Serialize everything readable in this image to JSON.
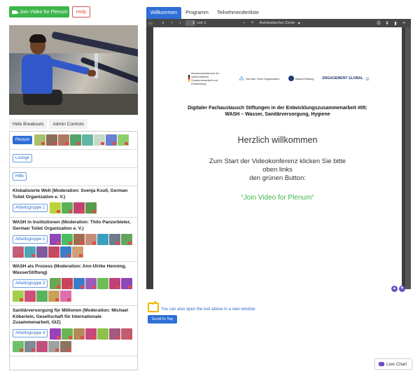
{
  "top_buttons": {
    "join": "Join Video for Plenum",
    "help": "Help"
  },
  "left_tabs": [
    "Hide Breakouts",
    "Admin Controls"
  ],
  "rooms": [
    {
      "title": "",
      "button": "Plenum",
      "primary": true,
      "avatars": [
        "#a8c16a",
        "#8a6d5a",
        "#b07a62",
        "#51a467",
        "#60b5a6",
        "#c5d9c5",
        "#6b7ecf",
        "#8fcf6b"
      ]
    },
    {
      "title": "",
      "button": "Lounge",
      "primary": false,
      "avatars": []
    },
    {
      "title": "",
      "button": "Hilfe",
      "primary": false,
      "avatars": []
    },
    {
      "title": "Klobalisierte Welt (Moderation: Svenja Ksoll, German Toilet Organization e. V.)",
      "button": "Arbeitsgruppe 1",
      "primary": false,
      "avatars": [
        "#b9d33b",
        "#5bb05a",
        "#c0426e",
        "#5c9a4d"
      ]
    },
    {
      "title": "WASH in Institutionen (Moderation: Thilo Panzerbieter, German Toilet Organization e. V.)",
      "button": "Arbeitsgruppe 2",
      "primary": false,
      "avatars": [
        "#8e48b8",
        "#4bbe5f",
        "#a06c50",
        "#c68d7a",
        "#3a9ec0",
        "#6f7a8a",
        "#63a55d",
        "#c0607b",
        "#4da6b8",
        "#7d5a9e",
        "#c14b62",
        "#3b7ec7",
        "#d0a070"
      ]
    },
    {
      "title": "WASH als Prozess (Moderation: Ann-Ulrike Henning, WasserStiftung)",
      "button": "Arbeitsgruppe 3",
      "primary": false,
      "avatars": [
        "#6aa84f",
        "#c9435c",
        "#3d7cc9",
        "#9a5fb8",
        "#6cbf57",
        "#c0407a",
        "#8e48b8",
        "#a3ce4b",
        "#d04f7a",
        "#5db15c",
        "#c8a25a",
        "#e06fb0"
      ]
    },
    {
      "title": "Sanitärversorgung für Millionen (Moderation: Michael Köberlein, Gesellschaft für Internationale Zusammenarbeit, GIZ)",
      "button": "Arbeitsgruppe 4",
      "primary": false,
      "avatars": [
        "#9a40b8",
        "#6db552",
        "#b58a5a",
        "#c6487a",
        "#8bc34a",
        "#a3597c",
        "#c25b6d",
        "#6fc06a",
        "#7e8a95",
        "#c0507a",
        "#a0a0a0",
        "#8a7560"
      ]
    }
  ],
  "right_tabs": [
    "Willkommen",
    "Programm",
    "Teilnehmendenliste"
  ],
  "toolbar": {
    "page": "1",
    "of": "von 1",
    "zoom": "Automatischer Zoom"
  },
  "document": {
    "logos": [
      "Bundesministerium für wirtschaftliche Zusammenarbeit und Entwicklung",
      "German Toilet Organization",
      "WasserStiftung",
      "ENGAGEMENT GLOBAL"
    ],
    "title_line1": "Digitaler Fachaustausch Stiftungen in der Entwicklungszusammenarbeit #05:",
    "title_line2": "WASH – Wasser, Sanitärversorgung, Hygiene",
    "welcome": "Herzlich willkommen",
    "instr_line1": "Zum Start der Videokonferenz klicken Sie bitte",
    "instr_line2": "oben links",
    "instr_line3": "den grünen Button:",
    "cta": "“Join Video for Plenum“"
  },
  "new_window_text": "You can also open the tool above in a new window.",
  "scroll_top": "Scroll to Top",
  "live_chat": "Live Chat!"
}
